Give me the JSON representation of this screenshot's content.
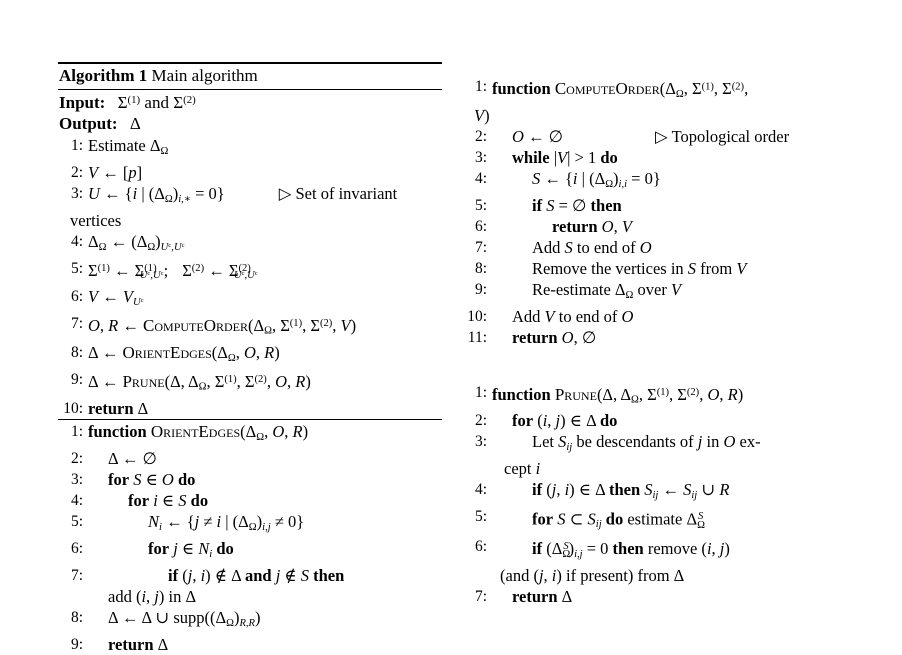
{
  "figure": {
    "kind": "algorithm-pseudocode",
    "columns": 2
  },
  "left_column": {
    "header": {
      "label": "Algorithm 1",
      "title": "Main algorithm"
    },
    "io": {
      "input_label": "Input:",
      "input_value": "Σ(1) and Σ(2)",
      "output_label": "Output:",
      "output_value": "Δ"
    },
    "main_algorithm": {
      "lines": [
        {
          "num": "1:",
          "text": "Estimate ΔΩ"
        },
        {
          "num": "2:",
          "text": "V ← [p]"
        },
        {
          "num": "3:",
          "text": "U ← {i | (ΔΩ)i,* = 0}",
          "comment": "▷ Set of invariant",
          "continuation": "vertices"
        },
        {
          "num": "4:",
          "text": "ΔΩ ← (ΔΩ)Uc,Uc"
        },
        {
          "num": "5:",
          "text": "Σ(1) ← Σ(1)Uc,Uc;   Σ(2) ← Σ(2)Uc,Uc"
        },
        {
          "num": "6:",
          "text": "V ← VUc"
        },
        {
          "num": "7:",
          "text": "O, R ← COMPUTEORDER(ΔΩ, Σ(1), Σ(2), V)"
        },
        {
          "num": "8:",
          "text": "Δ ← ORIENTEDGES(ΔΩ, O, R)"
        },
        {
          "num": "9:",
          "text": "Δ ← PRUNE(Δ, ΔΩ, Σ(1), Σ(2), O, R)"
        },
        {
          "num": "10:",
          "text": "return Δ"
        }
      ]
    },
    "orient_edges": {
      "lines": [
        {
          "num": "1:",
          "text": "function ORIENTEDGES(ΔΩ, O, R)"
        },
        {
          "num": "2:",
          "text": "Δ ← ∅"
        },
        {
          "num": "3:",
          "text": "for S ∈ O do"
        },
        {
          "num": "4:",
          "text": "for i ∈ S do"
        },
        {
          "num": "5:",
          "text": "Ni ← {j ≠ i | (ΔΩ)i,j ≠ 0}"
        },
        {
          "num": "6:",
          "text": "for j ∈ Ni do"
        },
        {
          "num": "7:",
          "text": "if (j, i) ∉ Δ and j ∉ S then",
          "continuation": "add (i, j) in Δ"
        },
        {
          "num": "8:",
          "text": "Δ ← Δ ∪ supp((ΔΩ)R,R)"
        },
        {
          "num": "9:",
          "text": "return Δ"
        }
      ]
    }
  },
  "right_column": {
    "compute_order": {
      "lines": [
        {
          "num": "1:",
          "text": "function COMPUTEORDER(ΔΩ, Σ(1), Σ(2),",
          "continuation": "V)"
        },
        {
          "num": "2:",
          "text": "O ← ∅",
          "comment": "▷ Topological order"
        },
        {
          "num": "3:",
          "text": "while |V| > 1 do"
        },
        {
          "num": "4:",
          "text": "S ← {i | (ΔΩ)i,i = 0}"
        },
        {
          "num": "5:",
          "text": "if S = ∅ then"
        },
        {
          "num": "6:",
          "text": "return O, V"
        },
        {
          "num": "7:",
          "text": "Add S to end of O"
        },
        {
          "num": "8:",
          "text": "Remove the vertices in S from V"
        },
        {
          "num": "9:",
          "text": "Re-estimate ΔΩ over V"
        },
        {
          "num": "10:",
          "text": "Add V to end of O"
        },
        {
          "num": "11:",
          "text": "return O, ∅"
        }
      ]
    },
    "prune": {
      "lines": [
        {
          "num": "1:",
          "text": "function PRUNE(Δ, ΔΩ, Σ(1), Σ(2), O, R)"
        },
        {
          "num": "2:",
          "text": "for (i, j) ∈ Δ do"
        },
        {
          "num": "3:",
          "text": "Let Sij be descendants of j in O ex-",
          "continuation": "cept i"
        },
        {
          "num": "4:",
          "text": "if (j, i) ∈ Δ then Sij ← Sij ∪ R"
        },
        {
          "num": "5:",
          "text": "for S ⊂ Sij do estimate ΔΩS"
        },
        {
          "num": "6:",
          "text": "if (ΔΩS)i,j = 0 then remove (i, j)",
          "continuation": "(and (j, i) if present) from Δ"
        },
        {
          "num": "7:",
          "text": "return Δ"
        }
      ]
    }
  }
}
